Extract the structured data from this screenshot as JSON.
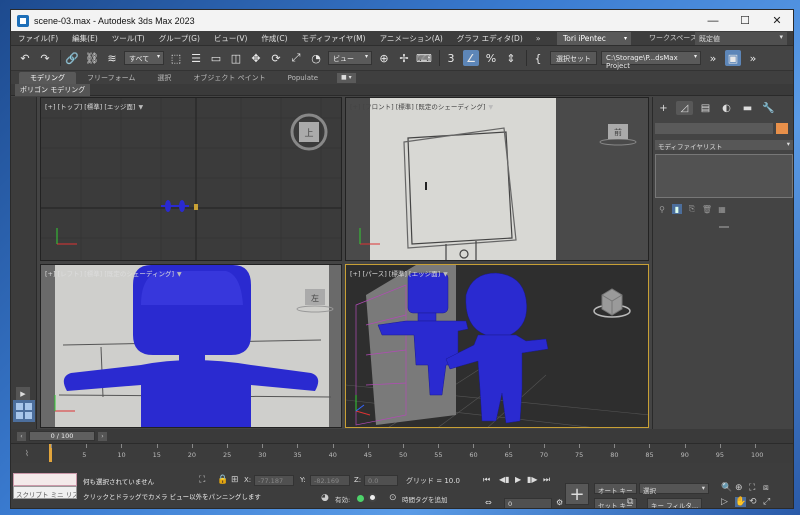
{
  "window": {
    "title": "scene-03.max - Autodesk 3ds Max 2023"
  },
  "menu": {
    "items": [
      "ファイル(F)",
      "編集(E)",
      "ツール(T)",
      "グループ(G)",
      "ビュー(V)",
      "作成(C)",
      "モディファイヤ(M)",
      "アニメーション(A)",
      "グラフ エディタ(D)"
    ],
    "more": "»",
    "user": "Tori iPentec",
    "workspace_label": "ワークスペース:",
    "workspace_value": "既定値"
  },
  "toolbar": {
    "selection_filter": "すべて",
    "view_coord": "ビュー",
    "named_selection": "選択セット",
    "project_path": "C:\\Storage\\P...dsMax Project"
  },
  "ribbon": {
    "tabs": [
      "モデリング",
      "フリーフォーム",
      "選択",
      "オブジェクト ペイント",
      "Populate"
    ],
    "subtab": "ポリゴン モデリング"
  },
  "viewports": {
    "top": {
      "label": "[+] [トップ] [標準] [エッジ面]",
      "cube_label": "上"
    },
    "front": {
      "label": "[+] [フロント] [標準] [既定のシェーディング]",
      "cube_label": "前"
    },
    "left": {
      "label": "[+] [レフト] [標準] [既定のシェーディング]",
      "cube_label": "左"
    },
    "persp": {
      "label": "[+] [パース] [標準] [エッジ面]"
    }
  },
  "command_panel": {
    "modifier_list": "モディファイヤリスト"
  },
  "timeline": {
    "slider": "0 / 100",
    "ticks": [
      "0",
      "5",
      "10",
      "15",
      "20",
      "25",
      "30",
      "35",
      "40",
      "45",
      "50",
      "55",
      "60",
      "65",
      "70",
      "75",
      "80",
      "85",
      "90",
      "95",
      "100"
    ]
  },
  "status": {
    "script_label": "スクリプト ミニ リス",
    "message_1": "何も選択されていません",
    "message_2": "クリックとドラッグでカメラ ビュー以外をパンニングします",
    "x_label": "X:",
    "x_value": "-77.187",
    "y_label": "Y:",
    "y_value": "-82.169",
    "z_label": "Z:",
    "z_value": "0.0",
    "grid": "グリッド = 10.0",
    "enable_label": "有効:",
    "add_time_tag": "時間タグを追加",
    "frame_value": "0",
    "auto_key": "オート キー",
    "set_key": "セット キー",
    "selection_dropdown": "選択",
    "key_filter": "キー フィルタ..."
  },
  "colors": {
    "accent_blue": "#4c6e9c",
    "model_blue": "#2a2ad0",
    "active_border": "#c8a035",
    "swatch": "#e8904a"
  }
}
